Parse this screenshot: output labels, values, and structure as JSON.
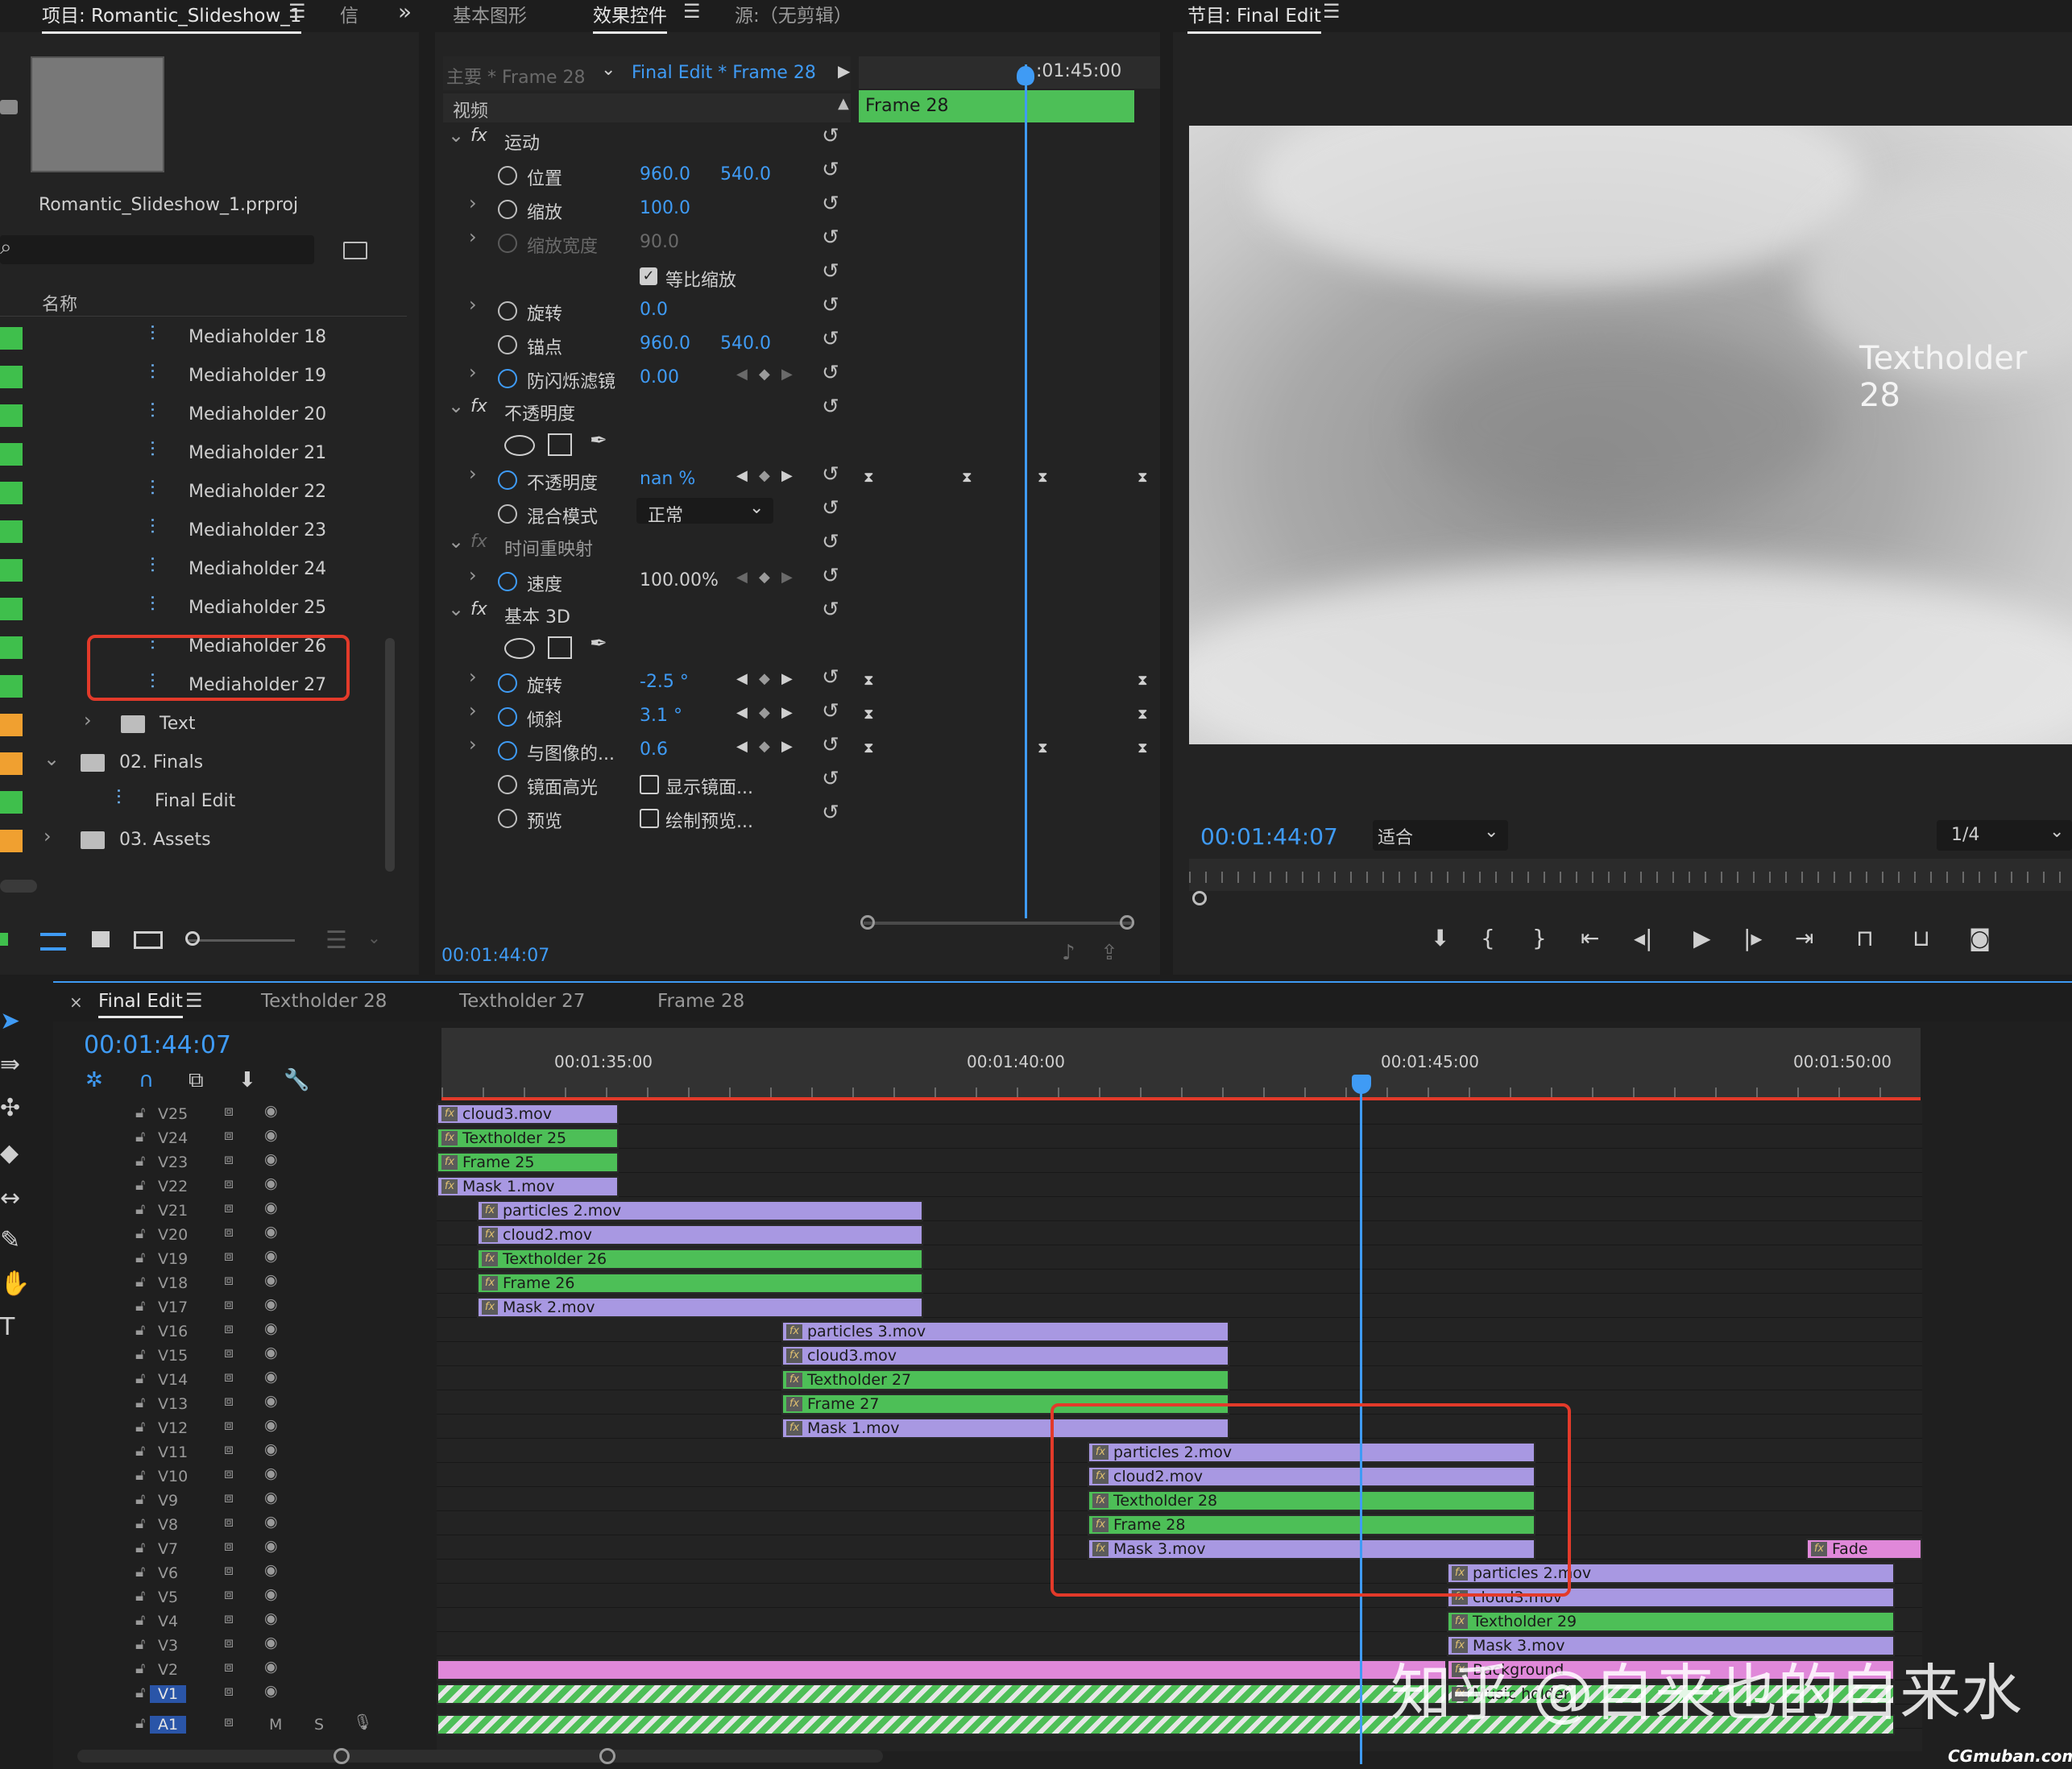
{
  "project": {
    "tab_title": "项目: Romantic_Slideshow_1",
    "tab_info": "信",
    "filename": "Romantic_Slideshow_1.prproj",
    "column_name": "名称",
    "items": [
      {
        "label": "Mediaholder 18",
        "color": "#3fbf4c",
        "type": "sequence"
      },
      {
        "label": "Mediaholder 19",
        "color": "#3fbf4c",
        "type": "sequence"
      },
      {
        "label": "Mediaholder 20",
        "color": "#3fbf4c",
        "type": "sequence"
      },
      {
        "label": "Mediaholder 21",
        "color": "#3fbf4c",
        "type": "sequence"
      },
      {
        "label": "Mediaholder 22",
        "color": "#3fbf4c",
        "type": "sequence"
      },
      {
        "label": "Mediaholder 23",
        "color": "#3fbf4c",
        "type": "sequence"
      },
      {
        "label": "Mediaholder 24",
        "color": "#3fbf4c",
        "type": "sequence"
      },
      {
        "label": "Mediaholder 25",
        "color": "#3fbf4c",
        "type": "sequence"
      },
      {
        "label": "Mediaholder 26",
        "color": "#3fbf4c",
        "type": "sequence"
      },
      {
        "label": "Mediaholder 27",
        "color": "#3fbf4c",
        "type": "sequence"
      },
      {
        "label": "Text",
        "color": "#f0a030",
        "type": "folder"
      },
      {
        "label": "02. Finals",
        "color": "#f0a030",
        "type": "folder"
      },
      {
        "label": "Final Edit",
        "color": "#3fbf4c",
        "type": "sequence"
      },
      {
        "label": "03. Assets",
        "color": "#f0a030",
        "type": "folder"
      }
    ]
  },
  "effects": {
    "tabs": [
      "基本图形",
      "效果控件",
      "源:（无剪辑）"
    ],
    "master_label": "主要 * Frame 28",
    "sequence_label": "Final Edit * Frame 28",
    "timecode_ruler": ":01:45:00",
    "clip_name": "Frame 28",
    "section_video": "视频",
    "motion": {
      "title": "运动",
      "position_label": "位置",
      "position_x": "960.0",
      "position_y": "540.0",
      "scale_label": "缩放",
      "scale_value": "100.0",
      "scale_width_label": "缩放宽度",
      "scale_width_value": "90.0",
      "uniform_label": "等比缩放",
      "rotation_label": "旋转",
      "rotation_value": "0.0",
      "anchor_label": "锚点",
      "anchor_x": "960.0",
      "anchor_y": "540.0",
      "flicker_label": "防闪烁滤镜",
      "flicker_value": "0.00"
    },
    "opacity": {
      "title": "不透明度",
      "opacity_label": "不透明度",
      "opacity_value": "nan %",
      "blend_label": "混合模式",
      "blend_value": "正常"
    },
    "time_remap": {
      "title": "时间重映射",
      "speed_label": "速度",
      "speed_value": "100.00%"
    },
    "basic3d": {
      "title": "基本 3D",
      "rotate_label": "旋转",
      "rotate_value": "-2.5 °",
      "tilt_label": "倾斜",
      "tilt_value": "3.1 °",
      "distance_label": "与图像的...",
      "distance_value": "0.6",
      "specular_label": "镜面高光",
      "specular_check": "显示镜面...",
      "preview_label": "预览",
      "preview_check": "绘制预览..."
    },
    "current_time": "00:01:44:07"
  },
  "program": {
    "title": "节目: Final Edit",
    "overlay_text": "Textholder 28",
    "timecode": "00:01:44:07",
    "fit_label": "适合",
    "resolution": "1/4"
  },
  "timeline": {
    "tabs": [
      "Final Edit",
      "Textholder 28",
      "Textholder 27",
      "Frame 28"
    ],
    "timecode": "00:01:44:07",
    "ruler": [
      "00:01:35:00",
      "00:01:40:00",
      "00:01:45:00",
      "00:01:50:00"
    ],
    "tracks": [
      "V25",
      "V24",
      "V23",
      "V22",
      "V21",
      "V20",
      "V19",
      "V18",
      "V17",
      "V16",
      "V15",
      "V14",
      "V13",
      "V12",
      "V11",
      "V10",
      "V9",
      "V8",
      "V7",
      "V6",
      "V5",
      "V4",
      "V3",
      "V2",
      "V1"
    ],
    "audio_track": "A1",
    "audio_m": "M",
    "audio_s": "S",
    "clips": [
      {
        "track": 0,
        "label": "cloud3.mov",
        "color": "purple",
        "start": 0,
        "end": 1
      },
      {
        "track": 1,
        "label": "Textholder 25",
        "color": "green",
        "start": 0,
        "end": 1
      },
      {
        "track": 2,
        "label": "Frame 25",
        "color": "green",
        "start": 0,
        "end": 1
      },
      {
        "track": 3,
        "label": "Mask 1.mov",
        "color": "purple",
        "start": 0,
        "end": 1
      },
      {
        "track": 4,
        "label": "particles 2.mov",
        "color": "purple",
        "start": 1,
        "end": 2
      },
      {
        "track": 5,
        "label": "cloud2.mov",
        "color": "purple",
        "start": 1,
        "end": 2
      },
      {
        "track": 6,
        "label": "Textholder 26",
        "color": "green",
        "start": 1,
        "end": 2
      },
      {
        "track": 7,
        "label": "Frame 26",
        "color": "green",
        "start": 1,
        "end": 2
      },
      {
        "track": 8,
        "label": "Mask 2.mov",
        "color": "purple",
        "start": 1,
        "end": 2
      },
      {
        "track": 9,
        "label": "particles 3.mov",
        "color": "purple",
        "start": 2,
        "end": 3
      },
      {
        "track": 10,
        "label": "cloud3.mov",
        "color": "purple",
        "start": 2,
        "end": 3
      },
      {
        "track": 11,
        "label": "Textholder 27",
        "color": "green",
        "start": 2,
        "end": 3
      },
      {
        "track": 12,
        "label": "Frame 27",
        "color": "green",
        "start": 2,
        "end": 3
      },
      {
        "track": 13,
        "label": "Mask 1.mov",
        "color": "purple",
        "start": 2,
        "end": 3
      },
      {
        "track": 14,
        "label": "particles 2.mov",
        "color": "purple",
        "start": 3,
        "end": 4
      },
      {
        "track": 15,
        "label": "cloud2.mov",
        "color": "purple",
        "start": 3,
        "end": 4
      },
      {
        "track": 16,
        "label": "Textholder 28",
        "color": "green",
        "start": 3,
        "end": 4
      },
      {
        "track": 17,
        "label": "Frame 28",
        "color": "green",
        "start": 3,
        "end": 4
      },
      {
        "track": 18,
        "label": "Mask 3.mov",
        "color": "purple",
        "start": 3,
        "end": 4
      },
      {
        "track": 18,
        "label": "Fade",
        "color": "pink",
        "start": 5,
        "end": 6
      },
      {
        "track": 19,
        "label": "particles 2.mov",
        "color": "purple",
        "start": 4,
        "end": 5
      },
      {
        "track": 20,
        "label": "cloud3.mov",
        "color": "purple",
        "start": 4,
        "end": 5
      },
      {
        "track": 21,
        "label": "Textholder 29",
        "color": "green",
        "start": 4,
        "end": 5
      },
      {
        "track": 22,
        "label": "Mask 3.mov",
        "color": "purple",
        "start": 4,
        "end": 5
      },
      {
        "track": 23,
        "label": "Background",
        "color": "pink",
        "start": 6,
        "end": 7
      },
      {
        "track": 24,
        "label": "Music holder",
        "color": "hatch",
        "start": 6,
        "end": 7
      }
    ]
  },
  "watermark": "知乎 @自来也的自来水",
  "credit": "CGmuban.com"
}
